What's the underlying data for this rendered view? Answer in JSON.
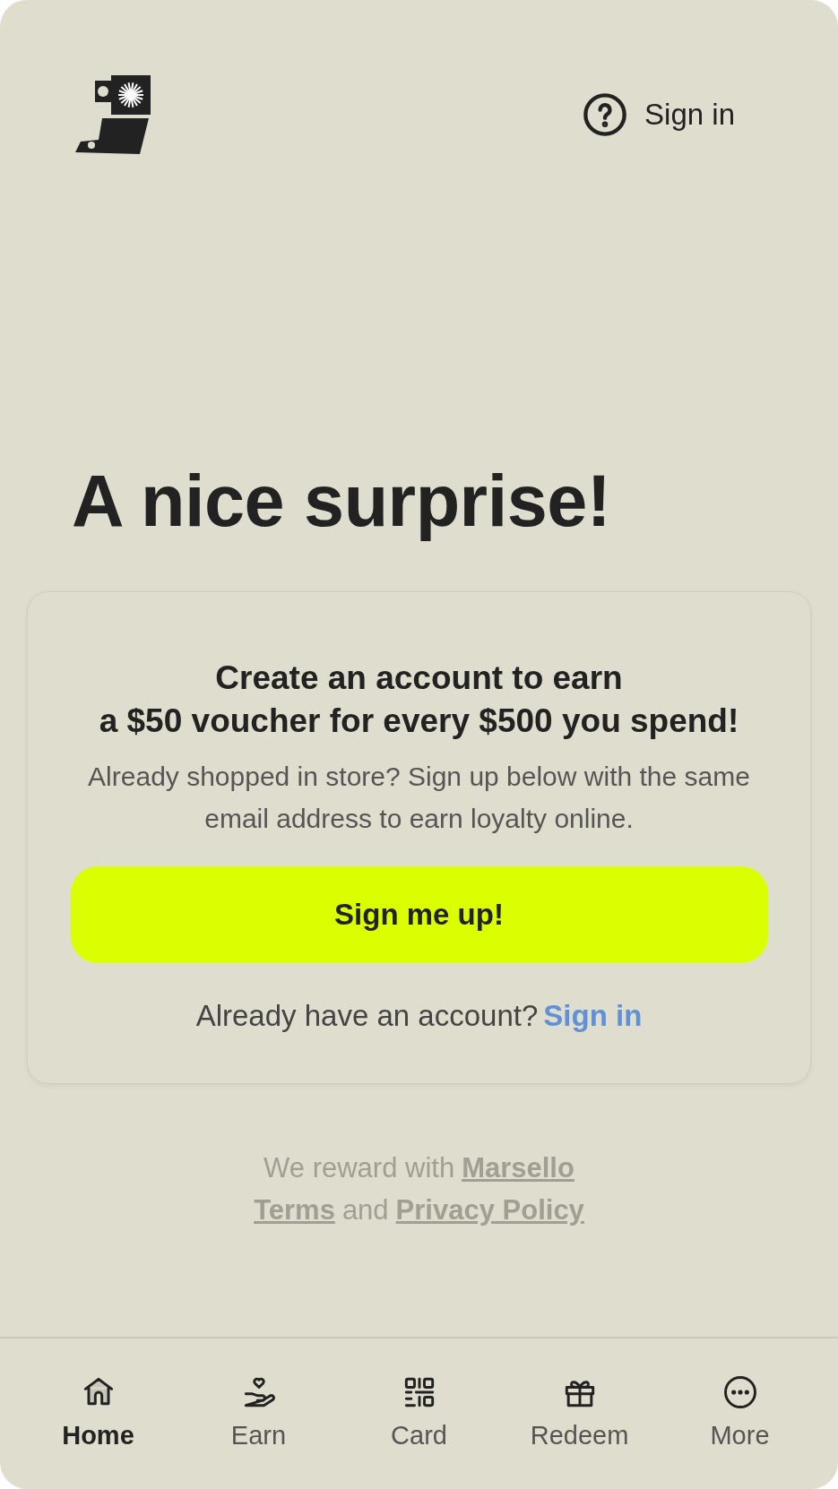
{
  "header": {
    "help_link": "Sign in"
  },
  "heading": "A nice surprise!",
  "card": {
    "title_lines": [
      "Create an account to earn",
      "a $50 voucher for every $500 you spend!"
    ],
    "description": "Already shopped in store? Sign up below with the same email address to earn loyalty online.",
    "button": "Sign me up!",
    "account_prompt": "Already have an account?",
    "account_link": "Sign in"
  },
  "footer": {
    "reward_text": "We reward with",
    "reward_link": "Marsello",
    "terms_link": "Terms",
    "joiner": "and",
    "privacy_link": "Privacy Policy"
  },
  "nav": [
    {
      "label": "Home",
      "selected": true
    },
    {
      "label": "Earn",
      "selected": false
    },
    {
      "label": "Card",
      "selected": false
    },
    {
      "label": "Redeem",
      "selected": false
    },
    {
      "label": "More",
      "selected": false
    }
  ]
}
